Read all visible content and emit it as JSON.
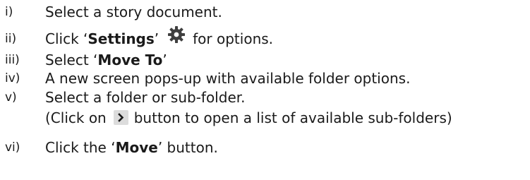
{
  "steps": [
    {
      "number": "i)",
      "text": "Select a story document."
    },
    {
      "number": "ii)",
      "before": "Click ‘",
      "bold": "Settings",
      "after": "’",
      "icon": "gear-icon",
      "after_icon": "for options."
    },
    {
      "number": "iii)",
      "before": "Select ‘",
      "bold": "Move To",
      "after": "’"
    },
    {
      "number": "iv)",
      "text": "A new screen pops-up with available folder options."
    },
    {
      "number": "v)",
      "text": "Select a folder or sub-folder."
    },
    {
      "number": "",
      "before": "(Click on",
      "icon": "chevron-right-icon",
      "after": "button to open a list of available sub-folders)"
    },
    {
      "number": "vi)",
      "before": "Click the ‘",
      "bold": "Move",
      "after": "’ button."
    }
  ]
}
